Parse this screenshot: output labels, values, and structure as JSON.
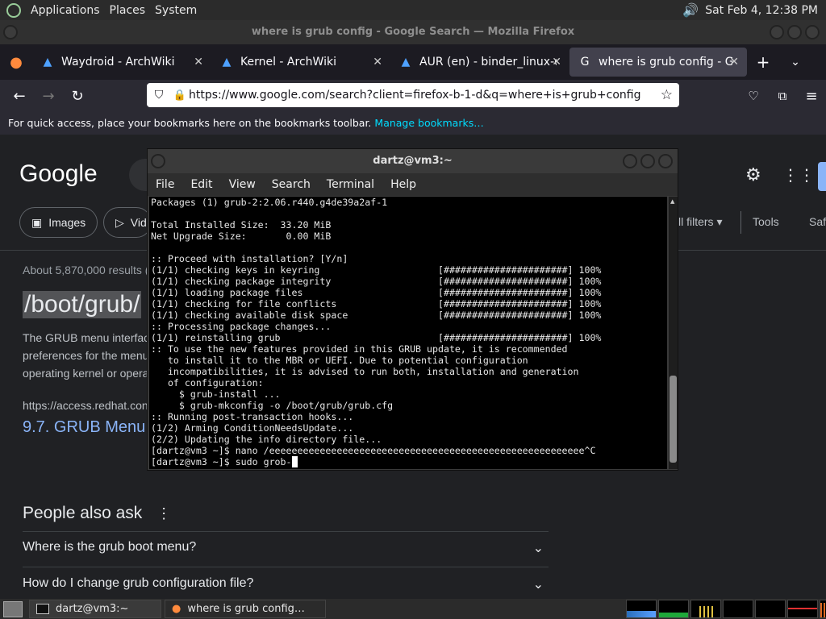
{
  "panel": {
    "menus": [
      "Applications",
      "Places",
      "System"
    ],
    "datetime": "Sat Feb  4, 12:38 PM"
  },
  "firefox": {
    "window_title": "where is grub config - Google Search — Mozilla Firefox",
    "tabs": [
      {
        "label": "Waydroid - ArchWiki",
        "icon": "archwiki-icon"
      },
      {
        "label": "Kernel - ArchWiki",
        "icon": "archwiki-icon"
      },
      {
        "label": "AUR (en) - binder_linux-dkms",
        "icon": "archwiki-icon"
      },
      {
        "label": "where is grub config - Google Search",
        "icon": "google-icon"
      }
    ],
    "url": "https://www.google.com/search?client=firefox-b-1-d&q=where+is+grub+config",
    "bookmarks_text": "For quick access, place your bookmarks here on the bookmarks toolbar.",
    "bookmarks_link": "Manage bookmarks…"
  },
  "google": {
    "logo": "Google",
    "chips": [
      "Images",
      "Vid"
    ],
    "right_tools": [
      "ll filters",
      "Tools",
      "Saf"
    ],
    "results_count": "About 5,870,000 results (",
    "snippet_highlight": "/boot/grub/",
    "snippet_lines": [
      "The GRUB menu interfac",
      "preferences for the menu",
      "operating kernel or opera"
    ],
    "source_url": "https://access.redhat.con",
    "result_title": "9.7. GRUB Menu",
    "paa_title": "People also ask",
    "paa_questions": [
      "Where is the grub boot menu?",
      "How do I change grub configuration file?"
    ]
  },
  "terminal": {
    "title": "dartz@vm3:~",
    "menu": [
      "File",
      "Edit",
      "View",
      "Search",
      "Terminal",
      "Help"
    ],
    "lines": [
      "Packages (1) grub-2:2.06.r440.g4de39a2af-1",
      "",
      "Total Installed Size:  33.20 MiB",
      "Net Upgrade Size:       0.00 MiB",
      "",
      ":: Proceed with installation? [Y/n]",
      "(1/1) checking keys in keyring                     [######################] 100%",
      "(1/1) checking package integrity                   [######################] 100%",
      "(1/1) loading package files                        [######################] 100%",
      "(1/1) checking for file conflicts                  [######################] 100%",
      "(1/1) checking available disk space                [######################] 100%",
      ":: Processing package changes...",
      "(1/1) reinstalling grub                            [######################] 100%",
      ":: To use the new features provided in this GRUB update, it is recommended",
      "   to install it to the MBR or UEFI. Due to potential configuration",
      "   incompatibilities, it is advised to run both, installation and generation",
      "   of configuration:",
      "     $ grub-install ...",
      "     $ grub-mkconfig -o /boot/grub/grub.cfg",
      ":: Running post-transaction hooks...",
      "(1/2) Arming ConditionNeedsUpdate...",
      "(2/2) Updating the info directory file...",
      "[dartz@vm3 ~]$ nano /eeeeeeeeeeeeeeeeeeeeeeeeeeeeeeeeeeeeeeeeeeeeeeeeeeeeeeee^C"
    ],
    "prompt_line": "[dartz@vm3 ~]$ sudo grob-"
  },
  "taskbar": {
    "tasks": [
      "dartz@vm3:~",
      "where is grub config…"
    ]
  }
}
